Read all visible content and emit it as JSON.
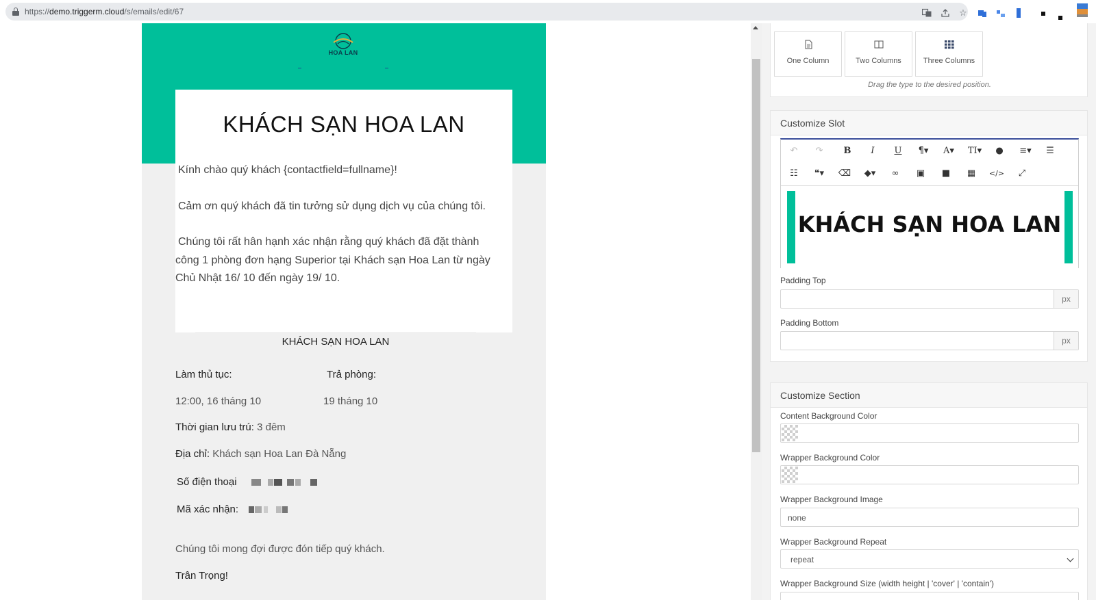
{
  "browser": {
    "url_prefix": "https://",
    "url_host": "demo.triggerm.cloud",
    "url_path": "/s/emails/edit/67"
  },
  "email": {
    "logo_text": "HOA LAN",
    "title": "KHÁCH SẠN HOA LAN",
    "greeting": "Kính chào quý khách {contactfield=fullname}!",
    "thanks": "Cảm ơn quý khách đã tin tưởng sử dụng dịch vụ của chúng tôi.",
    "confirm_line1": "Chúng tôi rất hân hạnh xác nhận rằng quý khách đã đặt thành",
    "confirm_line2": "công 1 phòng đơn hạng Superior tại Khách sạn Hoa Lan từ ngày",
    "confirm_line3": "Chủ Nhật 16/ 10 đến ngày 19/ 10.",
    "footer_title": "KHÁCH SẠN HOA LAN",
    "checkin_label": "Làm thủ tục:",
    "checkout_label": "Trả phòng:",
    "checkin_value": "12:00, 16 tháng 10",
    "checkout_value": "19 tháng 10",
    "stay_label": "Thời gian lưu trú:",
    "stay_value": "3 đêm",
    "address_label": "Địa chỉ:",
    "address_value": "Khách sạn Hoa Lan Đà Nẵng",
    "phone_label": "Số điện thoại",
    "code_label": "Mã xác nhận:",
    "closing": "Chúng tôi mong đợi được đón tiếp quý khách.",
    "signoff": "Trân Trọng!"
  },
  "layout_types": {
    "options": [
      {
        "label": "One Column",
        "icon": "document-icon"
      },
      {
        "label": "Two Columns",
        "icon": "two-columns-icon"
      },
      {
        "label": "Three Columns",
        "icon": "grid-icon"
      }
    ],
    "hint": "Drag the type to the desired position."
  },
  "customize_slot": {
    "title": "Customize Slot",
    "editor_content": "KHÁCH SẠN HOA LAN",
    "padding_top_label": "Padding Top",
    "padding_top_value": "",
    "padding_bottom_label": "Padding Bottom",
    "padding_bottom_value": "",
    "unit": "px"
  },
  "customize_section": {
    "title": "Customize Section",
    "content_bg_label": "Content Background Color",
    "wrapper_bg_label": "Wrapper Background Color",
    "wrapper_bg_image_label": "Wrapper Background Image",
    "wrapper_bg_image_value": "none",
    "wrapper_bg_repeat_label": "Wrapper Background Repeat",
    "wrapper_bg_repeat_value": "repeat",
    "wrapper_bg_size_label": "Wrapper Background Size (width height | 'cover' | 'contain')"
  },
  "colors": {
    "brand_green": "#00bf9a",
    "email_bg": "#f0f0f0",
    "editor_accent": "#3b4f9b"
  }
}
